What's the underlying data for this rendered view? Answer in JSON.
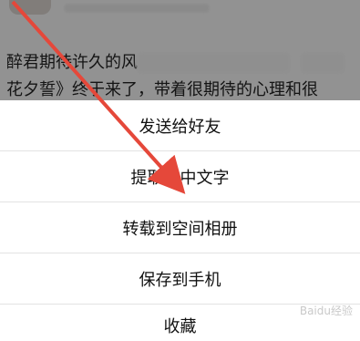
{
  "background_post": {
    "line1": "醉君期待许久的风",
    "line2": "花夕誓》终于来了，带着很期待的心理和很"
  },
  "action_sheet": {
    "items": [
      "发送给好友",
      "提取图中文字",
      "转载到空间相册",
      "保存到手机",
      "收藏"
    ]
  },
  "watermark": "Baidu经验",
  "colors": {
    "arrow": "#e5483a",
    "overlay": "rgba(0,0,0,0.40)"
  }
}
